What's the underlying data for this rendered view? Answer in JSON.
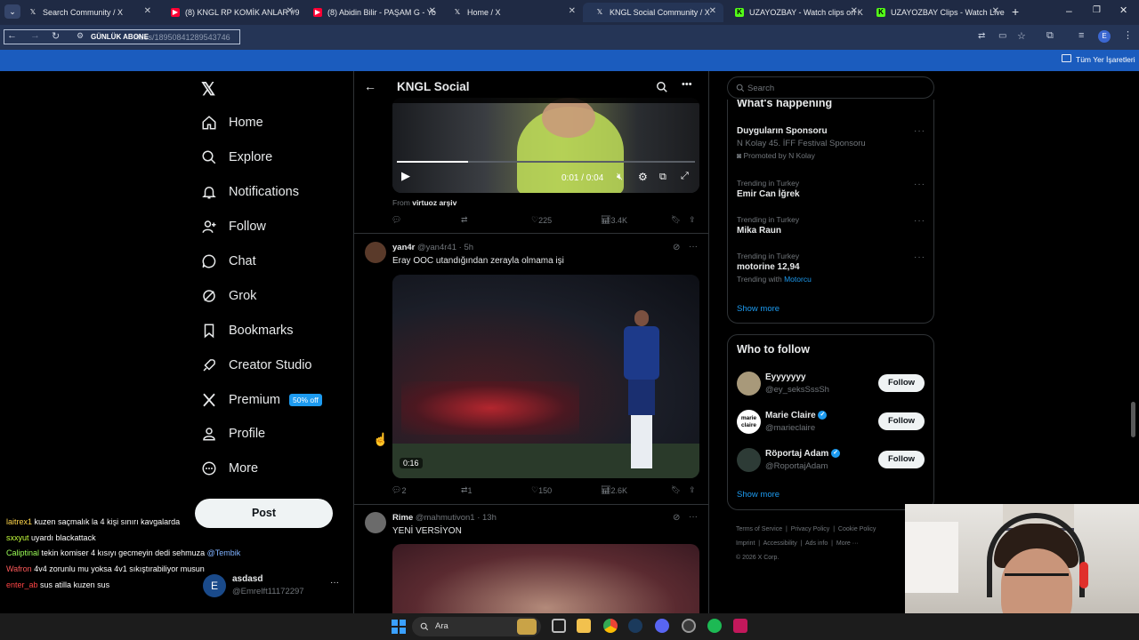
{
  "browser": {
    "tabs": [
      {
        "label": "Search Community / X",
        "icon": "x-logo",
        "color": "#000000"
      },
      {
        "label": "(8) KNGL RP KOMİK ANLAR #9",
        "icon": "youtube-icon",
        "color": "#ff0033"
      },
      {
        "label": "(8) Abidin Bilir - PAŞAM G - Yo",
        "icon": "youtube-icon",
        "color": "#ff0033"
      },
      {
        "label": "Home / X",
        "icon": "x-logo",
        "color": "#000000"
      },
      {
        "label": "KNGL Social Community / X",
        "icon": "x-logo",
        "color": "#000000"
      },
      {
        "label": "UZAYOZBAY - Watch clips on K",
        "icon": "kick-icon",
        "color": "#53fc18"
      },
      {
        "label": "UZAYOZBAY Clips - Watch Live",
        "icon": "kick-icon",
        "color": "#53fc18"
      }
    ],
    "url": "nities/18950841289543746",
    "url_overlay": "GÜNLÜK ABONE",
    "bookmark_folder": "Tüm Yer İşaretleri",
    "profile_initial": "E"
  },
  "nav": {
    "items": [
      "Home",
      "Explore",
      "Notifications",
      "Follow",
      "Chat",
      "Grok",
      "Bookmarks",
      "Creator Studio",
      "Premium",
      "Profile",
      "More"
    ],
    "premium_badge": "50% off",
    "post_button": "Post",
    "account": {
      "initial": "E",
      "name": "asdasd",
      "handle": "@Emrelft11172297"
    }
  },
  "feed": {
    "header_title": "KNGL Social",
    "post1": {
      "video_time": "0:01 / 0:04",
      "from_label": "From",
      "from_source": "virtuoz arşiv",
      "likes": "225",
      "views": "3.4K"
    },
    "post2": {
      "name": "yan4r",
      "handle": "@yan4r41",
      "age": "5h",
      "text": "Eray OOC utandığından zerayla olmama işi",
      "video_duration": "0:16",
      "replies": "2",
      "reposts": "1",
      "likes": "150",
      "views": "2.6K"
    },
    "post3": {
      "name": "Rime",
      "handle": "@mahmutivon1",
      "age": "13h",
      "text": "YENİ VERSİYON"
    }
  },
  "right": {
    "search_placeholder": "Search",
    "whats_happening": "What's happening",
    "trends": [
      {
        "title": "Duyguların Sponsoru",
        "sub": "N Kolay 45. İFF Festival Sponsoru",
        "promo": "Promoted by N Kolay"
      },
      {
        "meta": "Trending in Turkey",
        "title": "Emir Can İğrek"
      },
      {
        "meta": "Trending in Turkey",
        "title": "Mika Raun"
      },
      {
        "meta": "Trending in Turkey",
        "title": "motorine 12,94",
        "trending_with": "Trending with",
        "tag": "Motorcu"
      }
    ],
    "show_more": "Show more",
    "who_to_follow": "Who to follow",
    "follow_suggestions": [
      {
        "name": "Eyyyyyyy",
        "handle": "@ey_seksSssSh",
        "verified": false
      },
      {
        "name": "Marie Claire",
        "handle": "@marieclaire",
        "verified": true,
        "avatar_text": "marie claire"
      },
      {
        "name": "Röportaj Adam",
        "handle": "@RoportajAdam",
        "verified": true
      }
    ],
    "follow_label": "Follow",
    "footer": [
      "Terms of Service",
      "Privacy Policy",
      "Cookie Policy",
      "Imprint",
      "Accessibility",
      "Ads info",
      "More ···",
      "© 2026 X Corp."
    ]
  },
  "chat": [
    {
      "user": "laitrex1",
      "color": "#ffd54a",
      "msg": "kuzen saçmalık la 4 kişi sınırı kavgalarda"
    },
    {
      "user": "sxxyut",
      "color": "#c6ff3d",
      "msg": "uyardı blackattack"
    },
    {
      "user": "Caliptinal",
      "color": "#9cff57",
      "msg": "tekin komiser 4 kısıyı gecmeyin dedi sehmuza",
      "mention": "@Tembik"
    },
    {
      "user": "Wafron",
      "color": "#ff5a5a",
      "msg": "4v4 zorunlu mu yoksa 4v1 sıkıştırabiliyor musun"
    },
    {
      "user": "enter_ab",
      "color": "#ff4444",
      "msg": "sus atilla kuzen sus"
    }
  ],
  "taskbar": {
    "search_placeholder": "Ara"
  }
}
